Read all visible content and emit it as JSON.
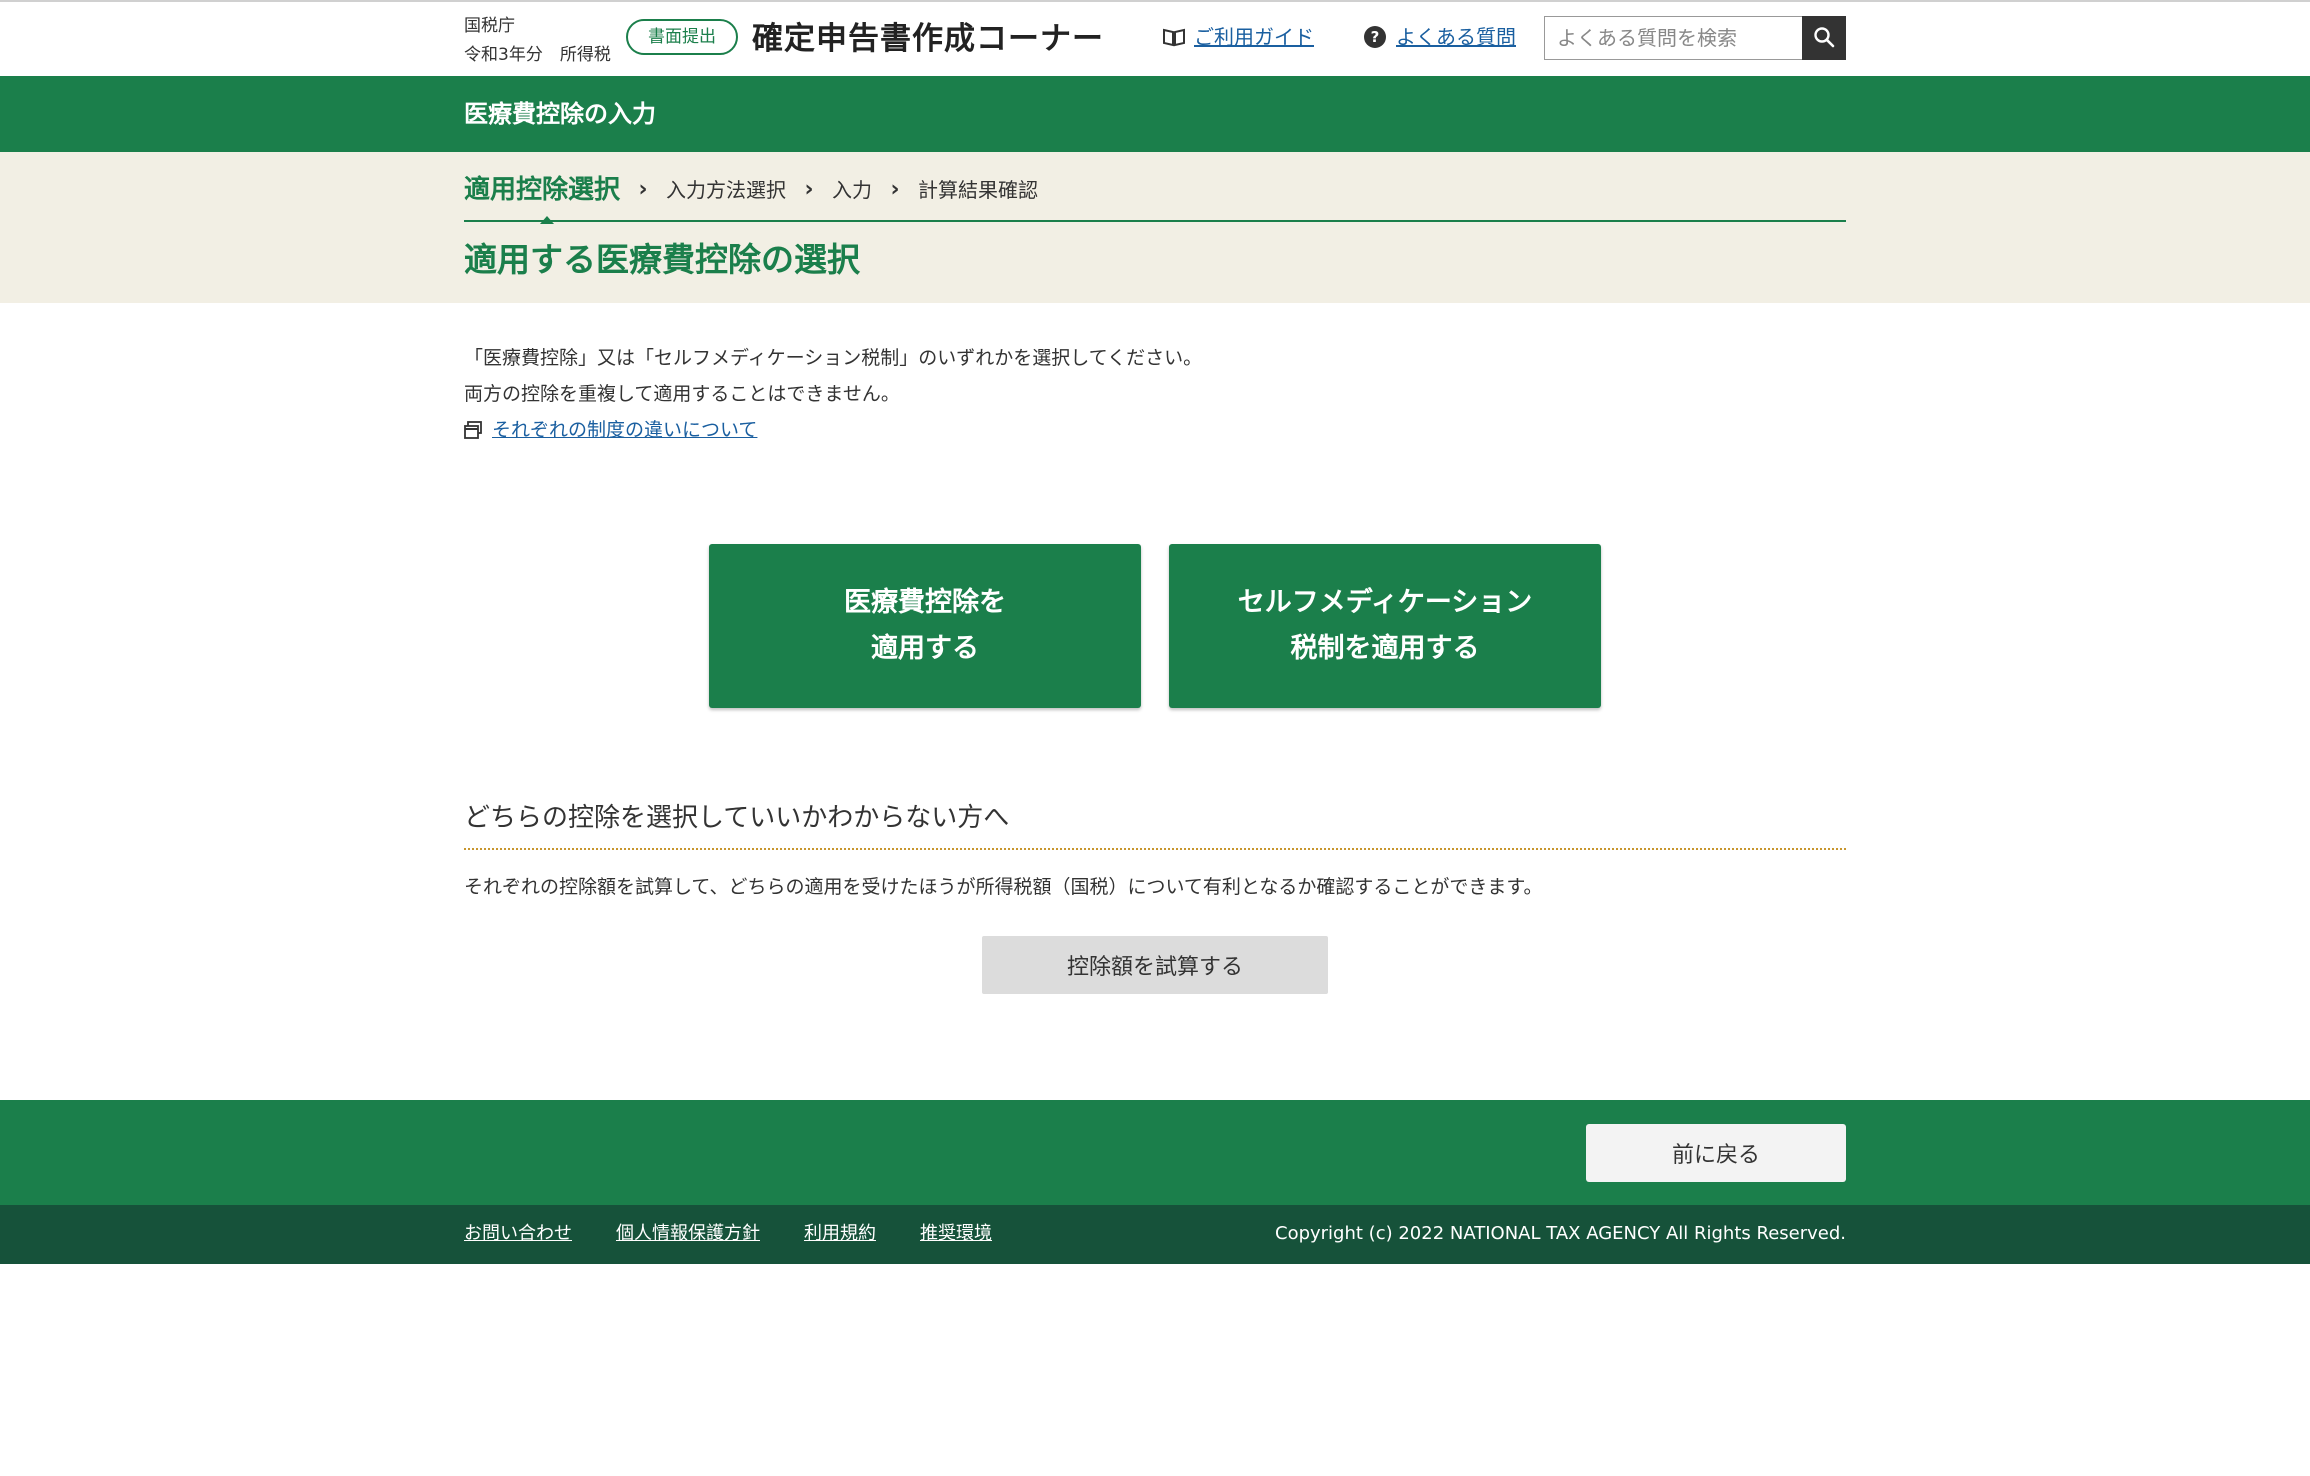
{
  "header": {
    "agency": "国税庁",
    "tax_year": "令和3年分　所得税",
    "submit_badge": "書面提出",
    "site_title": "確定申告書作成コーナー",
    "guide_label": "ご利用ガイド",
    "faq_label": "よくある質問",
    "search_placeholder": "よくある質問を検索"
  },
  "section_title": "医療費控除の入力",
  "steps": [
    {
      "label": "適用控除選択",
      "active": true
    },
    {
      "label": "入力方法選択",
      "active": false
    },
    {
      "label": "入力",
      "active": false
    },
    {
      "label": "計算結果確認",
      "active": false
    }
  ],
  "page_title": "適用する医療費控除の選択",
  "intro": {
    "line1": "「医療費控除」又は「セルフメディケーション税制」のいずれかを選択してください。",
    "line2": "両方の控除を重複して適用することはできません。",
    "link": "それぞれの制度の違いについて"
  },
  "choices": {
    "medical_line1": "医療費控除を",
    "medical_line2": "適用する",
    "self_line1": "セルフメディケーション",
    "self_line2": "税制を適用する"
  },
  "help": {
    "heading": "どちらの控除を選択していいかわからない方へ",
    "text": "それぞれの控除額を試算して、どちらの適用を受けたほうが所得税額（国税）について有利となるか確認することができます。",
    "calc_button": "控除額を試算する"
  },
  "footer": {
    "back_button": "前に戻る",
    "links": [
      "お問い合わせ",
      "個人情報保護方針",
      "利用規約",
      "推奨環境"
    ],
    "copyright": "Copyright (c) 2022 NATIONAL TAX AGENCY All Rights Reserved."
  },
  "colors": {
    "brand_green": "#1b7f4b",
    "footer_dark": "#16523a",
    "beige": "#f2efe4",
    "link": "#1a5fa0"
  }
}
